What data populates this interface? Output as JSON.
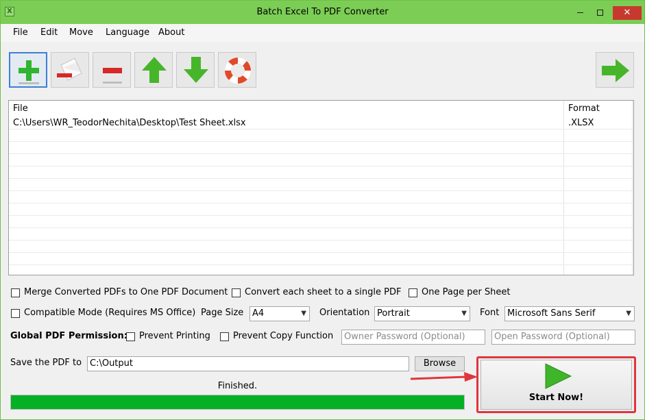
{
  "window": {
    "title": "Batch Excel To PDF Converter",
    "app_icon_glyph": "X",
    "close_glyph": "✕",
    "accent_color": "#7ccd55",
    "close_color": "#c7392f"
  },
  "menu": {
    "items": [
      "File",
      "Edit",
      "Move",
      "Language",
      "About"
    ]
  },
  "toolbar": {
    "icons": [
      "add-icon",
      "clear-list-icon",
      "remove-icon",
      "move-up-icon",
      "move-down-icon",
      "help-icon",
      "next-arrow-icon"
    ]
  },
  "file_list": {
    "columns": [
      "File",
      "Format"
    ],
    "rows": [
      [
        "C:\\Users\\WR_TeodorNechita\\Desktop\\Test Sheet.xlsx",
        ".XLSX"
      ]
    ]
  },
  "options": {
    "merge_label": "Merge Converted PDFs to One PDF Document",
    "merge_checked": false,
    "convert_sheet_label": "Convert each sheet to a single PDF",
    "convert_sheet_checked": false,
    "one_page_label": "One Page per Sheet",
    "one_page_checked": false,
    "compatible_label": "Compatible Mode (Requires MS Office)",
    "compatible_checked": false,
    "page_size_label": "Page Size",
    "page_size_value": "A4",
    "orientation_label": "Orientation",
    "orientation_value": "Portrait",
    "font_label": "Font",
    "font_value": "Microsoft Sans Serif"
  },
  "permission": {
    "label": "Global PDF Permission:",
    "prevent_printing_label": "Prevent Printing",
    "prevent_printing_checked": false,
    "prevent_copy_label": "Prevent Copy Function",
    "prevent_copy_checked": false,
    "owner_password_placeholder": "Owner Password (Optional)",
    "open_password_placeholder": "Open Password (Optional)"
  },
  "output": {
    "save_label": "Save the PDF to",
    "path_value": "C:\\Output",
    "browse_label": "Browse"
  },
  "status": {
    "text": "Finished.",
    "progress_percent": 100,
    "progress_color": "#06b025"
  },
  "start": {
    "label": "Start Now!",
    "highlight_color": "#e0353d"
  }
}
